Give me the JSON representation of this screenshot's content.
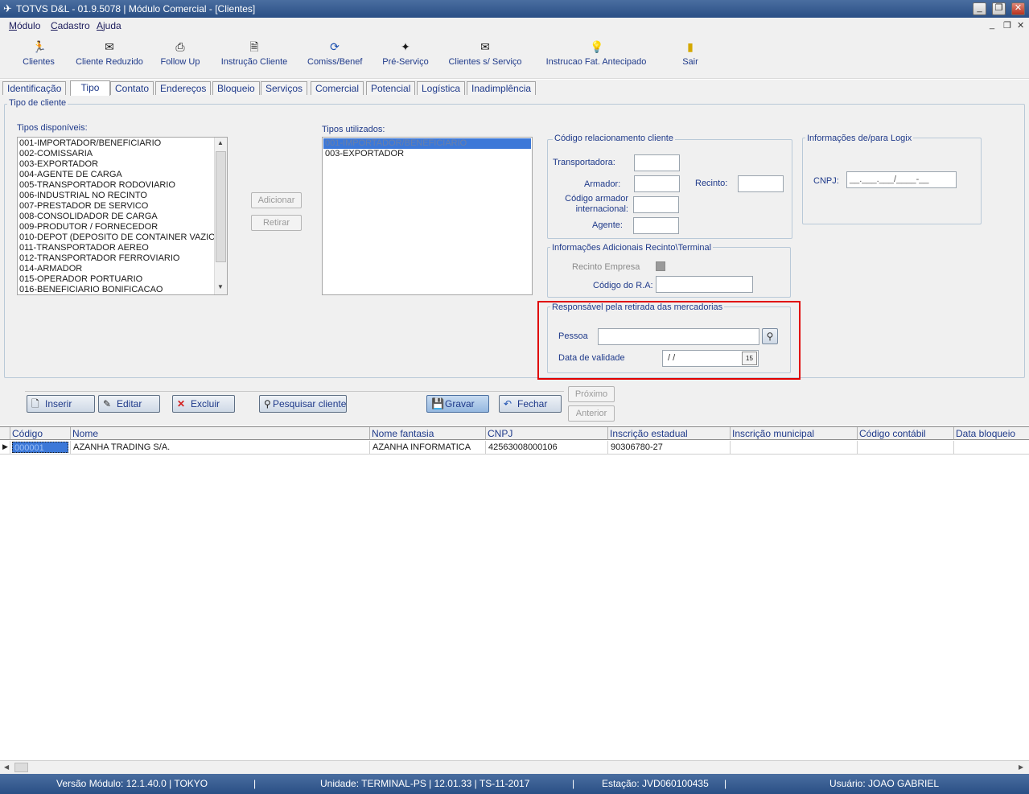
{
  "window": {
    "title": "TOTVS D&L - 01.9.5078 | Módulo Comercial - [Clientes]"
  },
  "menu": {
    "items": [
      "Módulo",
      "Cadastro",
      "Ajuda"
    ]
  },
  "toolbar": {
    "buttons": [
      {
        "label": "Clientes",
        "icon": "person-run-icon"
      },
      {
        "label": "Cliente Reduzido",
        "icon": "envelope-icon"
      },
      {
        "label": "Follow Up",
        "icon": "printer-icon"
      },
      {
        "label": "Instrução Cliente",
        "icon": "document-icon"
      },
      {
        "label": "Comiss/Benef",
        "icon": "refresh-icon"
      },
      {
        "label": "Pré-Serviço",
        "icon": "wand-icon"
      },
      {
        "label": "Clientes s/ Serviço",
        "icon": "envelope-icon"
      },
      {
        "label": "Instrucao Fat. Antecipado",
        "icon": "lamp-icon"
      },
      {
        "label": "Sair",
        "icon": "exit-door-icon"
      }
    ]
  },
  "tabs": [
    "Identificação",
    "Tipo",
    "Contato",
    "Endereços",
    "Bloqueio",
    "Serviços",
    "Comercial",
    "Potencial",
    "Logística",
    "Inadimplência"
  ],
  "active_tab": "Tipo",
  "tipo": {
    "group_title": "Tipo de cliente",
    "available_label": "Tipos disponíveis:",
    "available": [
      "001-IMPORTADOR/BENEFICIARIO",
      "002-COMISSARIA",
      "003-EXPORTADOR",
      "004-AGENTE DE CARGA",
      "005-TRANSPORTADOR RODOVIARIO",
      "006-INDUSTRIAL NO RECINTO",
      "007-PRESTADOR DE SERVICO",
      "008-CONSOLIDADOR DE CARGA",
      "009-PRODUTOR / FORNECEDOR",
      "010-DEPOT (DEPOSITO DE CONTAINER VAZIO)",
      "011-TRANSPORTADOR AEREO",
      "012-TRANSPORTADOR FERROVIARIO",
      "014-ARMADOR",
      "015-OPERADOR PORTUARIO",
      "016-BENEFICIARIO BONIFICACAO"
    ],
    "used_label": "Tipos utilizados:",
    "used": [
      "001-IMPORTADOR/BENEFICIARIO",
      "003-EXPORTADOR"
    ],
    "add_button": "Adicionar",
    "remove_button": "Retirar",
    "codigo_group": {
      "title": "Código relacionamento cliente",
      "transportadora": "Transportadora:",
      "armador": "Armador:",
      "recinto": "Recinto:",
      "codigo_armador": "Código armador internacional:",
      "agente": "Agente:"
    },
    "logix_group": {
      "title": "Informações de/para Logix",
      "cnpj_label": "CNPJ:",
      "cnpj_mask": "__.___.___/____-__"
    },
    "adicionais_group": {
      "title": "Informações Adicionais Recinto\\Terminal",
      "recinto_empresa": "Recinto Empresa",
      "codigo_ra": "Código do R.A:"
    },
    "responsavel_group": {
      "title": "Responsável pela retirada das mercadorias",
      "pessoa_label": "Pessoa",
      "data_label": "Data de validade",
      "data_value": " / /",
      "calendar_day": "15",
      "highlight_color": "#e00000"
    }
  },
  "actions": {
    "inserir": "Inserir",
    "editar": "Editar",
    "excluir": "Excluir",
    "pesquisar": "Pesquisar cliente",
    "gravar": "Gravar",
    "fechar": "Fechar",
    "proximo": "Próximo",
    "anterior": "Anterior"
  },
  "grid": {
    "columns": [
      "Código",
      "Nome",
      "Nome fantasia",
      "CNPJ",
      "Inscrição estadual",
      "Inscrição municipal",
      "Código contábil",
      "Data bloqueio"
    ],
    "rows": [
      [
        "000001",
        "AZANHA TRADING S/A.",
        "AZANHA INFORMATICA",
        "42563008000106",
        "90306780-27",
        "",
        "",
        ""
      ]
    ]
  },
  "status": {
    "versao": "Versão Módulo:  12.1.40.0  |  TOKYO",
    "unidade": "Unidade: TERMINAL-PS | 12.01.33 | TS-11-2017",
    "estacao": "Estação: JVD060100435",
    "usuario": "Usuário: JOAO GABRIEL"
  }
}
